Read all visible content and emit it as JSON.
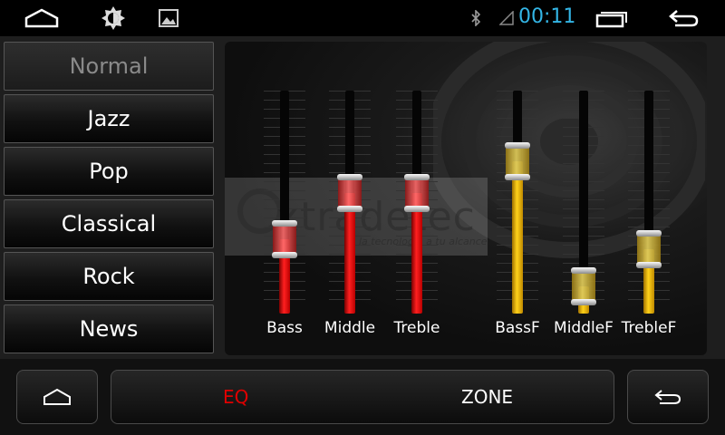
{
  "status_bar": {
    "time": "00:11",
    "icons": [
      "home-icon",
      "brightness-icon",
      "image-icon",
      "bluetooth-icon",
      "signal-icon",
      "recent-apps-icon",
      "back-icon"
    ]
  },
  "presets": [
    {
      "label": "Normal",
      "active": true
    },
    {
      "label": "Jazz",
      "active": false
    },
    {
      "label": "Pop",
      "active": false
    },
    {
      "label": "Classical",
      "active": false
    },
    {
      "label": "Rock",
      "active": false
    },
    {
      "label": "News",
      "active": false
    }
  ],
  "equalizer": {
    "bands": [
      {
        "label": "Bass",
        "level": 0.3,
        "color": "#e81010"
      },
      {
        "label": "Middle",
        "level": 0.55,
        "color": "#e81010"
      },
      {
        "label": "Treble",
        "level": 0.55,
        "color": "#e81010"
      },
      {
        "label": "BassF",
        "level": 0.72,
        "color": "#f5c400"
      },
      {
        "label": "MiddleF",
        "level": 0.05,
        "color": "#f5c400"
      },
      {
        "label": "TrebleF",
        "level": 0.25,
        "color": "#f5c400"
      }
    ]
  },
  "watermark": {
    "text": "xtradetec",
    "subtext": "la tecnología a tu alcance"
  },
  "bottom_bar": {
    "tabs": [
      {
        "label": "EQ",
        "active": true,
        "color": "#e00000"
      },
      {
        "label": "ZONE",
        "active": false,
        "color": "#ffffff"
      }
    ],
    "home_icon": "home-icon",
    "back_icon": "back-icon"
  }
}
